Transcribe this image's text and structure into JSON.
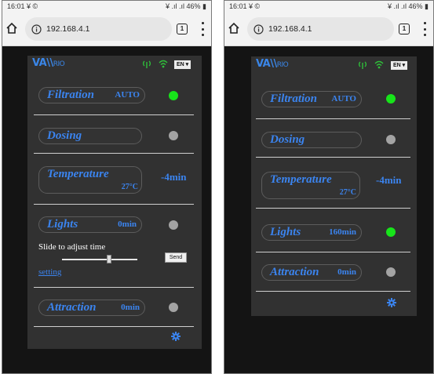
{
  "screens": [
    {
      "status": {
        "time": "16:01 ¥ ©",
        "right": "¥ .ıl .ıl 46% ▮"
      },
      "url": "192.168.4.1",
      "tabs_count": "1",
      "brand": {
        "logo": "VA\\\\RIO",
        "logo_main": "VA\\\\",
        "logo_tail": "RIO",
        "color": "#3a86e8"
      },
      "language": "EN ▾",
      "filtration": {
        "name": "Filtration",
        "value": "AUTO",
        "led": "on"
      },
      "dosing": {
        "name": "Dosing",
        "led": "off"
      },
      "temperature": {
        "name": "Temperature",
        "reading": "27°C",
        "side_value": "-4min"
      },
      "lights": {
        "name": "Lights",
        "value": "0min",
        "led": "off"
      },
      "slider": {
        "label": "Slide to adjust time",
        "position": 0.62,
        "send_label": "Send",
        "setting_label": "setting"
      },
      "attraction": {
        "name": "Attraction",
        "value": "0min",
        "led": "off"
      }
    },
    {
      "status": {
        "time": "16:01 ¥ ©",
        "right": "¥ .ıl .ıl 46% ▮"
      },
      "url": "192.168.4.1",
      "tabs_count": "1",
      "brand": {
        "logo": "VA\\\\RIO",
        "logo_main": "VA\\\\",
        "logo_tail": "RIO",
        "color": "#3a86e8"
      },
      "language": "EN ▾",
      "filtration": {
        "name": "Filtration",
        "value": "AUTO",
        "led": "on"
      },
      "dosing": {
        "name": "Dosing",
        "led": "off"
      },
      "temperature": {
        "name": "Temperature",
        "reading": "27°C",
        "side_value": "-4min"
      },
      "lights": {
        "name": "Lights",
        "value": "160min",
        "led": "on"
      },
      "attraction": {
        "name": "Attraction",
        "value": "0min",
        "led": "off"
      }
    }
  ],
  "colors": {
    "accent": "#3b84ef",
    "led_on": "#17e41a",
    "led_off": "#a3a3a3",
    "panel": "#313131"
  },
  "icons": [
    "home-icon",
    "info-icon",
    "tabs-icon",
    "menu-icon",
    "antenna-icon",
    "wifi-icon",
    "gear-icon"
  ]
}
